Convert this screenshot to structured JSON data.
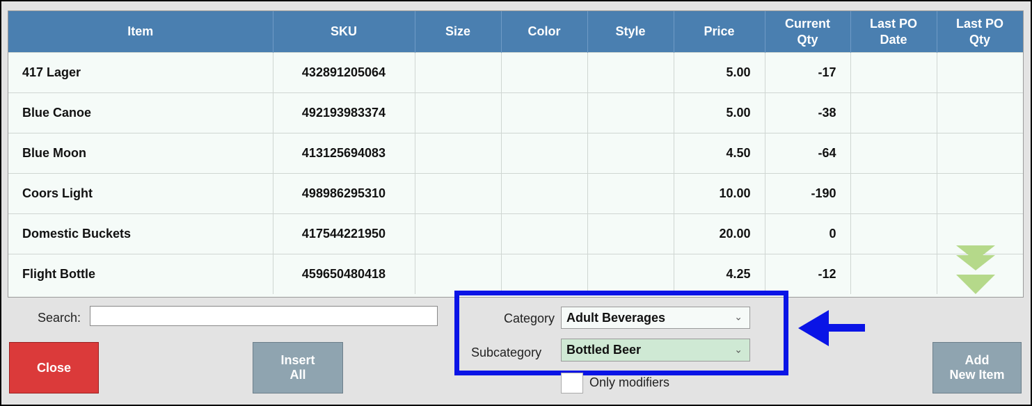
{
  "table": {
    "headers": [
      "Item",
      "SKU",
      "Size",
      "Color",
      "Style",
      "Price",
      "Current\nQty",
      "Last PO\nDate",
      "Last PO\nQty"
    ],
    "rows": [
      {
        "item": "417 Lager",
        "sku": "432891205064",
        "size": "",
        "color": "",
        "style": "",
        "price": "5.00",
        "qty": "-17",
        "last_po_date": "",
        "last_po_qty": ""
      },
      {
        "item": "Blue Canoe",
        "sku": "492193983374",
        "size": "",
        "color": "",
        "style": "",
        "price": "5.00",
        "qty": "-38",
        "last_po_date": "",
        "last_po_qty": ""
      },
      {
        "item": "Blue Moon",
        "sku": "413125694083",
        "size": "",
        "color": "",
        "style": "",
        "price": "4.50",
        "qty": "-64",
        "last_po_date": "",
        "last_po_qty": ""
      },
      {
        "item": "Coors Light",
        "sku": "498986295310",
        "size": "",
        "color": "",
        "style": "",
        "price": "10.00",
        "qty": "-190",
        "last_po_date": "",
        "last_po_qty": ""
      },
      {
        "item": "Domestic Buckets",
        "sku": "417544221950",
        "size": "",
        "color": "",
        "style": "",
        "price": "20.00",
        "qty": "0",
        "last_po_date": "",
        "last_po_qty": ""
      },
      {
        "item": "Flight Bottle",
        "sku": "459650480418",
        "size": "",
        "color": "",
        "style": "",
        "price": "4.25",
        "qty": "-12",
        "last_po_date": "",
        "last_po_qty": ""
      }
    ]
  },
  "search": {
    "label": "Search:",
    "value": ""
  },
  "filters": {
    "category_label": "Category",
    "category_value": "Adult Beverages",
    "subcategory_label": "Subcategory",
    "subcategory_value": "Bottled Beer",
    "only_modifiers_label": "Only modifiers"
  },
  "buttons": {
    "close": "Close",
    "insert_all": "Insert\nAll",
    "add_new_item": "Add\nNew Item"
  },
  "icons": {
    "scroll_down": "double-chevron-down-icon",
    "callout_arrow": "arrow-left-icon",
    "dropdown": "chevron-down-icon"
  },
  "colors": {
    "header_bg": "#4a7fb0",
    "close_button": "#db3a3a",
    "secondary_button": "#8fa4b0",
    "highlight_box": "#0a14e6",
    "scroll_arrow": "#b5d98a",
    "subcategory_bg": "#cfe9d4"
  }
}
